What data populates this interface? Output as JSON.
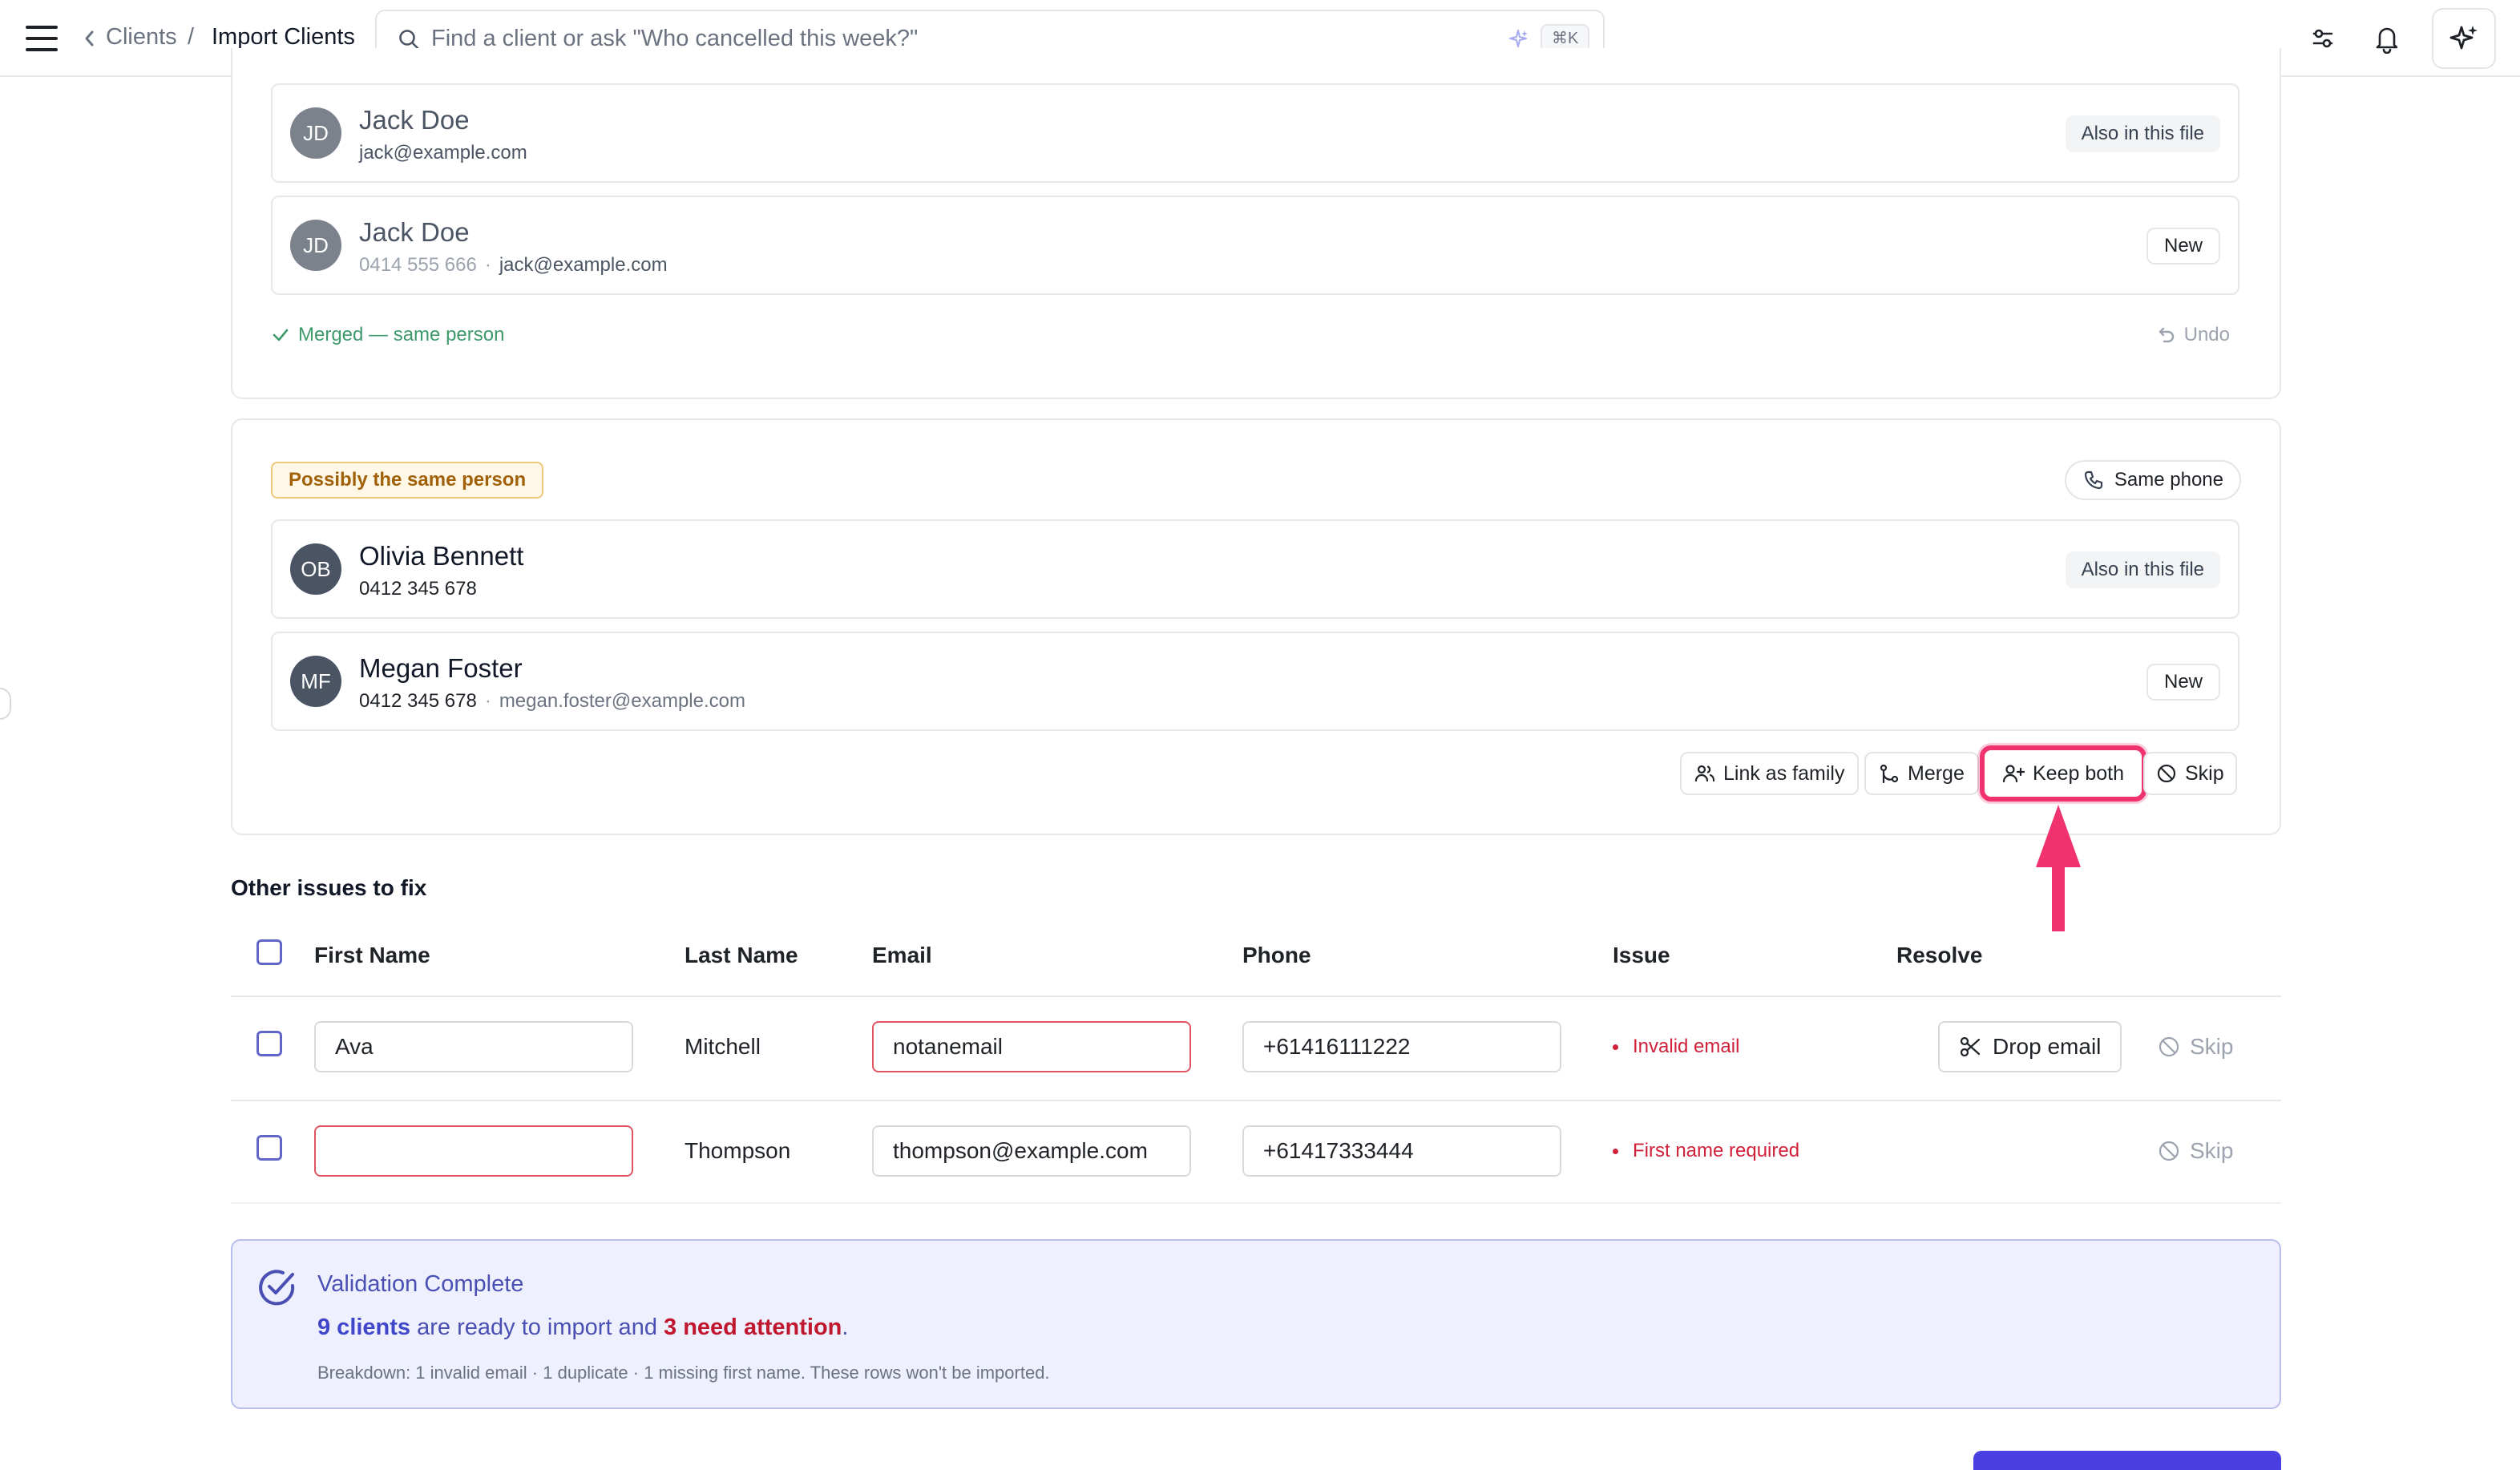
{
  "breadcrumb": {
    "parent": "Clients",
    "separator": "/",
    "current": "Import Clients"
  },
  "search": {
    "placeholder": "Find a client or ask \"Who cancelled this week?\"",
    "shortcut": "⌘K"
  },
  "merged_group": {
    "rows": [
      {
        "initials": "JD",
        "name": "Jack Doe",
        "phone": "",
        "email": "jack@example.com",
        "badge": "Also in this file"
      },
      {
        "initials": "JD",
        "name": "Jack Doe",
        "phone": "0414 555 666",
        "separator": "·",
        "email": "jack@example.com",
        "badge": "New"
      }
    ],
    "status": "Merged — same person",
    "undo_label": "Undo"
  },
  "duplicate_group": {
    "badge": "Possibly the same person",
    "reason": "Same phone",
    "rows": [
      {
        "initials": "OB",
        "name": "Olivia Bennett",
        "phone": "0412 345 678",
        "email": "",
        "badge": "Also in this file"
      },
      {
        "initials": "MF",
        "name": "Megan Foster",
        "phone": "0412 345 678",
        "separator": "·",
        "email": "megan.foster@example.com",
        "badge": "New"
      }
    ],
    "actions": {
      "link_family": "Link as family",
      "merge": "Merge",
      "keep_both": "Keep both",
      "skip": "Skip"
    }
  },
  "issues": {
    "title": "Other issues to fix",
    "columns": [
      "First Name",
      "Last Name",
      "Email",
      "Phone",
      "Issue",
      "Resolve"
    ],
    "rows": [
      {
        "first_name": "Ava",
        "last_name": "Mitchell",
        "email": "notanemail",
        "phone": "+61416111222",
        "issue": "Invalid email",
        "resolve": "Drop email",
        "skip": "Skip"
      },
      {
        "first_name": "",
        "last_name": "Thompson",
        "email": "thompson@example.com",
        "phone": "+61417333444",
        "issue": "First name required",
        "skip": "Skip"
      }
    ]
  },
  "validation": {
    "title": "Validation Complete",
    "ready": "9 clients",
    "mid": " are ready to import and ",
    "attention": "3 need attention",
    "end": ".",
    "breakdown": "Breakdown: 1 invalid email · 1 duplicate · 1 missing first name. These rows won't be imported."
  },
  "colors": {
    "accent": "#4a3fe0",
    "highlight": "#f0336e",
    "error": "#d0203a",
    "success": "#3f9a6b",
    "warning_bg": "#fff8e6",
    "warning_text": "#a1610a",
    "banner_bg": "#eef0fd"
  },
  "icons": [
    "menu-icon",
    "chevron-left-icon",
    "search-icon",
    "sparkle-icon",
    "filter-icon",
    "bell-icon",
    "assistant-sparkle-icon",
    "check-icon",
    "undo-icon",
    "phone-icon",
    "users-icon",
    "merge-icon",
    "user-plus-icon",
    "ban-icon",
    "scissors-icon",
    "check-circle-icon",
    "arrow-up-icon"
  ]
}
